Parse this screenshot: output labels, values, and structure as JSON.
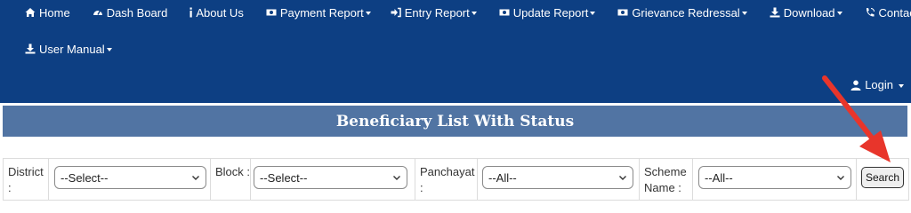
{
  "nav": {
    "home": "Home",
    "dashboard": "Dash Board",
    "about": "About Us",
    "payment_report": "Payment Report",
    "entry_report": "Entry Report",
    "update_report": "Update Report",
    "grievance": "Grievance Redressal",
    "download": "Download",
    "contact": "Contact Us",
    "user_manual": "User Manual"
  },
  "login": "Login",
  "page_title": "Beneficiary List With Status",
  "filters": {
    "district_label": "District :",
    "district_value": "--Select--",
    "block_label": "Block :",
    "block_value": "--Select--",
    "panchayat_label": "Panchayat :",
    "panchayat_value": "--All--",
    "scheme_label": "Scheme Name :",
    "scheme_value": "--All--",
    "search_label": "Search"
  },
  "colors": {
    "navbar_bg": "#0d3f83",
    "title_bg": "#5174a3",
    "annotation_arrow": "#e8352b"
  }
}
